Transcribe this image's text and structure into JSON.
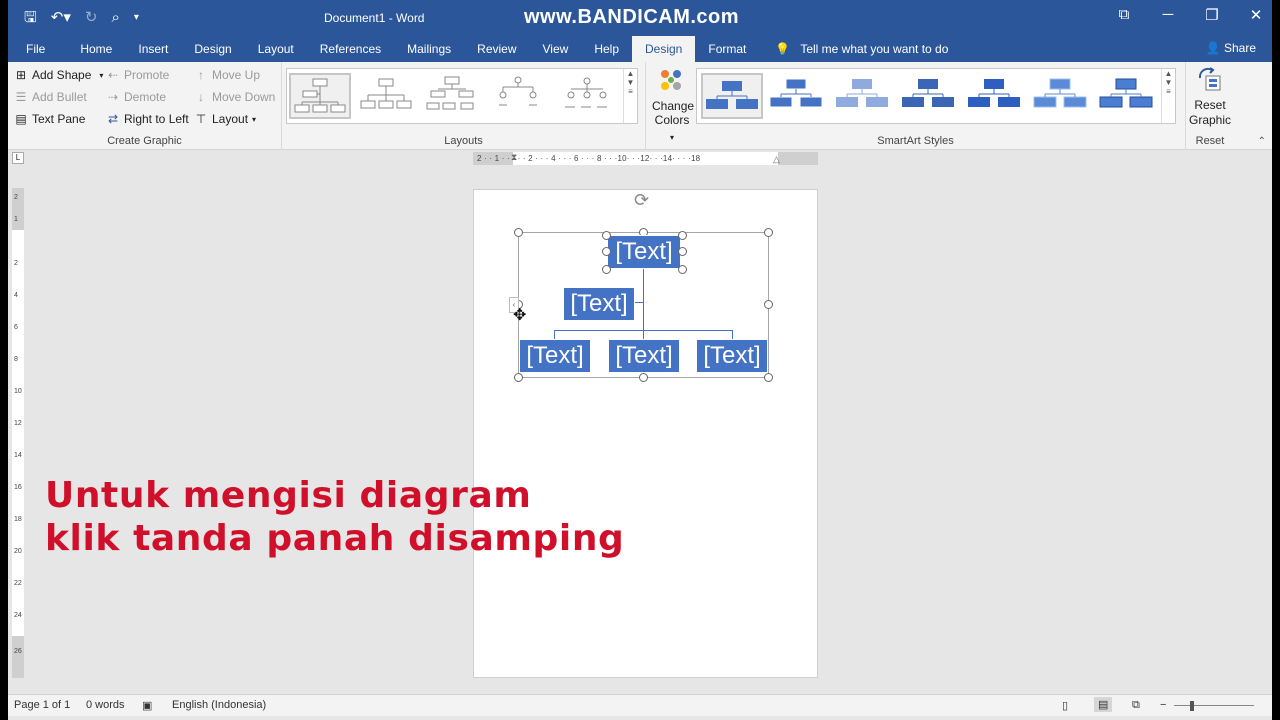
{
  "titlebar": {
    "doc_title": "Document1 - Word",
    "watermark": "www.BANDICAM.com",
    "qat": [
      "save-icon",
      "undo-icon",
      "redo-icon",
      "print-preview-icon",
      "customize-icon"
    ],
    "win_controls": [
      "restore-ribbon-icon",
      "minimize-icon",
      "restore-icon",
      "close-icon"
    ]
  },
  "tabs": [
    "File",
    "Home",
    "Insert",
    "Design",
    "Layout",
    "References",
    "Mailings",
    "Review",
    "View",
    "Help",
    "Design",
    "Format"
  ],
  "active_tab": "Design",
  "tell_me": "Tell me what you want to do",
  "share": "Share",
  "ribbon": {
    "create_graphic": {
      "label": "Create Graphic",
      "add_shape": "Add Shape",
      "add_bullet": "Add Bullet",
      "text_pane": "Text Pane",
      "promote": "Promote",
      "demote": "Demote",
      "right_to_left": "Right to Left",
      "move_up": "Move Up",
      "move_down": "Move Down",
      "layout": "Layout"
    },
    "layouts": {
      "label": "Layouts"
    },
    "smartart_styles": {
      "label": "SmartArt Styles",
      "change_colors_1": "Change",
      "change_colors_2": "Colors"
    },
    "reset": {
      "label": "Reset",
      "reset_graphic_1": "Reset",
      "reset_graphic_2": "Graphic"
    }
  },
  "ruler": {
    "h_nums": "2 · · 1 · · · · · 2 · · · 4 · · · 6 · · · 8 · · ·10· · ·12· · ·14· · · ·18",
    "v_nums": [
      "2",
      "1",
      "2",
      "4",
      "6",
      "8",
      "10",
      "12",
      "14",
      "16",
      "18",
      "20",
      "22",
      "24",
      "26"
    ]
  },
  "smartart": {
    "boxes": [
      "[Text]",
      "[Text]",
      "[Text]",
      "[Text]",
      "[Text]"
    ]
  },
  "overlay": {
    "line1": "Untuk mengisi diagram",
    "line2": "klik tanda panah disamping"
  },
  "status": {
    "page": "Page 1 of 1",
    "words": "0 words",
    "language": "English (Indonesia)"
  },
  "colors": {
    "word_blue": "#2b579a",
    "smartart_blue": "#4472c4",
    "overlay_red": "#d0102a"
  }
}
